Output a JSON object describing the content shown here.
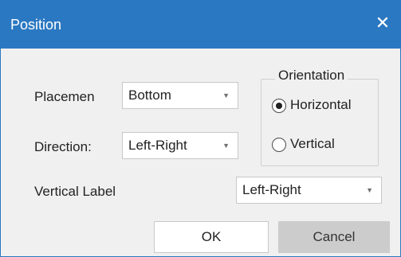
{
  "dialog": {
    "title": "Position",
    "close_icon": "close-icon",
    "close_glyph": "✕"
  },
  "placement": {
    "label": "Placemen",
    "value": "Bottom"
  },
  "direction": {
    "label": "Direction:",
    "value": "Left-Right"
  },
  "orientation": {
    "legend": "Orientation",
    "options": [
      {
        "label": "Horizontal",
        "selected": true
      },
      {
        "label": "Vertical",
        "selected": false
      }
    ]
  },
  "vertical_label": {
    "label": "Vertical Label",
    "value": "Left-Right"
  },
  "buttons": {
    "ok": "OK",
    "cancel": "Cancel"
  },
  "dropdown_icon": "chevron-down-icon",
  "dropdown_glyph": "▼",
  "colors": {
    "titlebar": "#2b78c2",
    "background": "#f0f0f0"
  }
}
